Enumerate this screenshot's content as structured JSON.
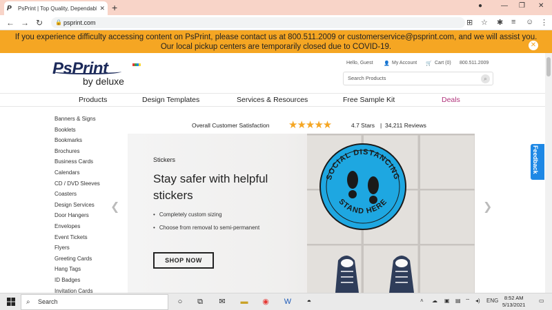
{
  "browser": {
    "tab_title": "PsPrint | Top Quality, Dependable",
    "tab_favicon": "P",
    "url": "psprint.com"
  },
  "notice": {
    "line1": "If you experience difficulty accessing content on PsPrint, please contact us at 800.511.2009 or customerservice@psprint.com, and we will assist you.",
    "line2": "Our local pickup centers are temporarily closed due to COVID-19."
  },
  "header": {
    "logo_brand": "PsPrint",
    "logo_sub": "by deluxe",
    "greeting": "Hello, Guest",
    "my_account": "My Account",
    "cart": "Cart (0)",
    "phone": "800.511.2009",
    "search_placeholder": "Search Products"
  },
  "nav": {
    "products": "Products",
    "design_templates": "Design Templates",
    "services": "Services & Resources",
    "sample_kit": "Free Sample Kit",
    "deals": "Deals"
  },
  "categories": [
    "Banners & Signs",
    "Booklets",
    "Bookmarks",
    "Brochures",
    "Business Cards",
    "Calendars",
    "CD / DVD Sleeves",
    "Coasters",
    "Design Services",
    "Door Hangers",
    "Envelopes",
    "Event Tickets",
    "Flyers",
    "Greeting Cards",
    "Hang Tags",
    "ID Badges",
    "Invitation Cards"
  ],
  "satisfaction": {
    "label": "Overall Customer Satisfaction",
    "rating_stars": 4.7,
    "stars_text": "4.7 Stars",
    "reviews": "34,211 Reviews",
    "separator": "|"
  },
  "hero": {
    "tag": "Stickers",
    "headline": "Stay safer with helpful stickers",
    "bullets": [
      "Completely custom sizing",
      "Choose from removal to semi-permanent"
    ],
    "cta": "SHOP NOW",
    "sticker_top": "SOCIAL DISTANCING",
    "sticker_bottom": "STAND HERE"
  },
  "feedback": "Feedback",
  "taskbar": {
    "search": "Search",
    "lang": "ENG",
    "time": "8:52 AM",
    "date": "5/13/2021"
  },
  "colors": {
    "notice_bg": "#f5a623",
    "brand_navy": "#1c2a5a",
    "deals": "#b0327a",
    "sticker_blue": "#1ea7e1",
    "feedback_bg": "#1e88e5"
  }
}
